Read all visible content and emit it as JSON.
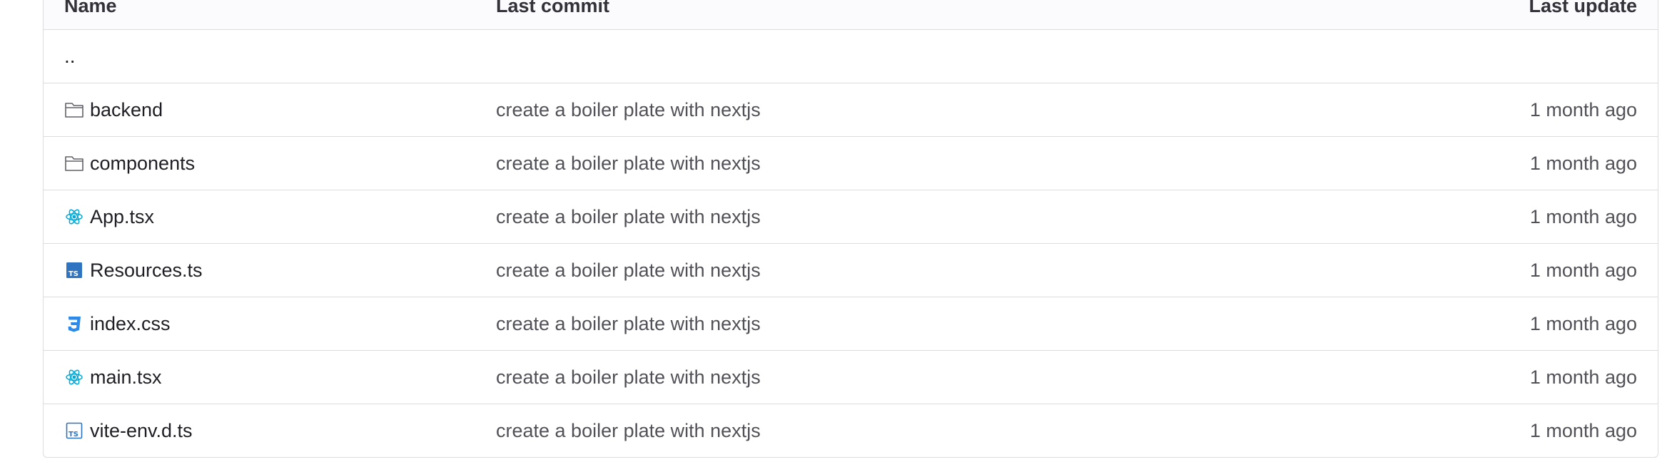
{
  "table": {
    "headers": {
      "name": "Name",
      "last_commit": "Last commit",
      "last_update": "Last update"
    },
    "parent_dir": "..",
    "rows": [
      {
        "name": "backend",
        "icon": "folder-icon",
        "commit": "create a boiler plate with nextjs",
        "updated": "1 month ago"
      },
      {
        "name": "components",
        "icon": "folder-icon",
        "commit": "create a boiler plate with nextjs",
        "updated": "1 month ago"
      },
      {
        "name": "App.tsx",
        "icon": "react-icon",
        "commit": "create a boiler plate with nextjs",
        "updated": "1 month ago"
      },
      {
        "name": "Resources.ts",
        "icon": "typescript-icon",
        "commit": "create a boiler plate with nextjs",
        "updated": "1 month ago"
      },
      {
        "name": "index.css",
        "icon": "css-icon",
        "commit": "create a boiler plate with nextjs",
        "updated": "1 month ago"
      },
      {
        "name": "main.tsx",
        "icon": "react-icon",
        "commit": "create a boiler plate with nextjs",
        "updated": "1 month ago"
      },
      {
        "name": "vite-env.d.ts",
        "icon": "typescript-outline-icon",
        "commit": "create a boiler plate with nextjs",
        "updated": "1 month ago"
      }
    ]
  },
  "colors": {
    "border": "#dcdcde",
    "header_bg": "#fbfafd",
    "react": "#00a9d6",
    "typescript": "#2f74c0",
    "css": "#2d8ae8",
    "folder": "#626168"
  }
}
